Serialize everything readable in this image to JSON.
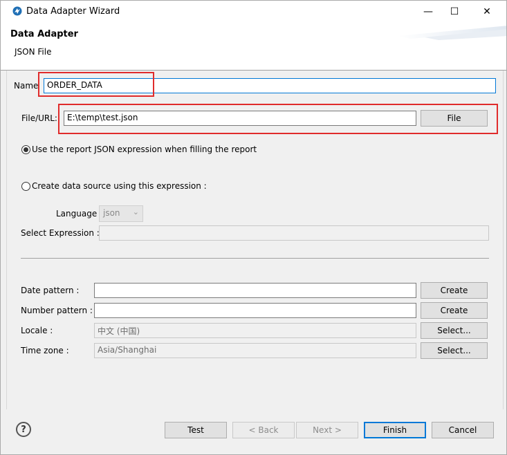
{
  "window": {
    "title": "Data Adapter Wizard",
    "minimize_icon": "minimize-icon",
    "maximize_icon": "maximize-icon",
    "close_icon": "close-icon",
    "minimize_glyph": "—",
    "maximize_glyph": "☐",
    "close_glyph": "✕"
  },
  "header": {
    "title": "Data Adapter",
    "subtitle": "JSON File"
  },
  "form": {
    "name_label": "Name",
    "name_value": "ORDER_DATA",
    "file_label": "File/URL:",
    "file_value": "E:\\temp\\test.json",
    "file_button": "File",
    "radio_report": "Use the report JSON expression when filling the report",
    "radio_expression": "Create data source using this expression :",
    "language_label": "Language",
    "language_value": "json",
    "select_expression_label": "Select Expression :",
    "select_expression_value": "",
    "date_pattern_label": "Date pattern :",
    "date_pattern_value": "",
    "number_pattern_label": "Number pattern :",
    "number_pattern_value": "",
    "create_label": "Create",
    "locale_label": "Locale :",
    "locale_value": "中文 (中国)",
    "timezone_label": "Time zone :",
    "timezone_value": "Asia/Shanghai",
    "select_label": "Select..."
  },
  "footer": {
    "help_glyph": "?",
    "test": "Test",
    "back": "< Back",
    "next": "Next >",
    "finish": "Finish",
    "cancel": "Cancel"
  },
  "colors": {
    "accent": "#0078d7",
    "highlight": "#e02b2b"
  }
}
